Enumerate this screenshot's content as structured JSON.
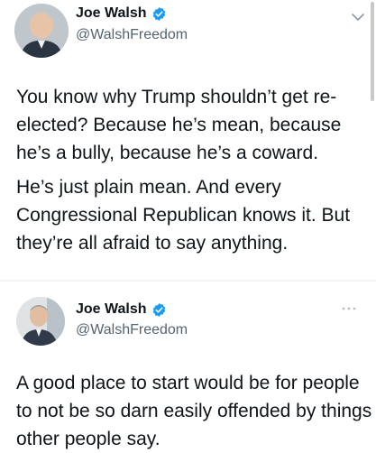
{
  "tweets": [
    {
      "display_name": "Joe Walsh",
      "handle": "@WalshFreedom",
      "paragraphs": [
        "You know why Trump shouldn’t get re-elected? Because he’s mean, because he’s a bully, because he’s a coward.",
        "He’s just plain mean. And every Congressional Republican knows it. But they’re all afraid to say anything."
      ],
      "menu_icon": "chevron-down-icon",
      "verified_icon": "verified-badge-icon"
    },
    {
      "display_name": "Joe Walsh",
      "handle": "@WalshFreedom",
      "paragraphs": [
        "A good place to start would be for people to not be so darn easily offended by things other people say."
      ],
      "menu_icon": "more-icon",
      "verified_icon": "verified-badge-icon"
    }
  ],
  "colors": {
    "verified_blue": "#1d9bf0",
    "text_primary": "#0f1419",
    "text_secondary": "#536471"
  }
}
